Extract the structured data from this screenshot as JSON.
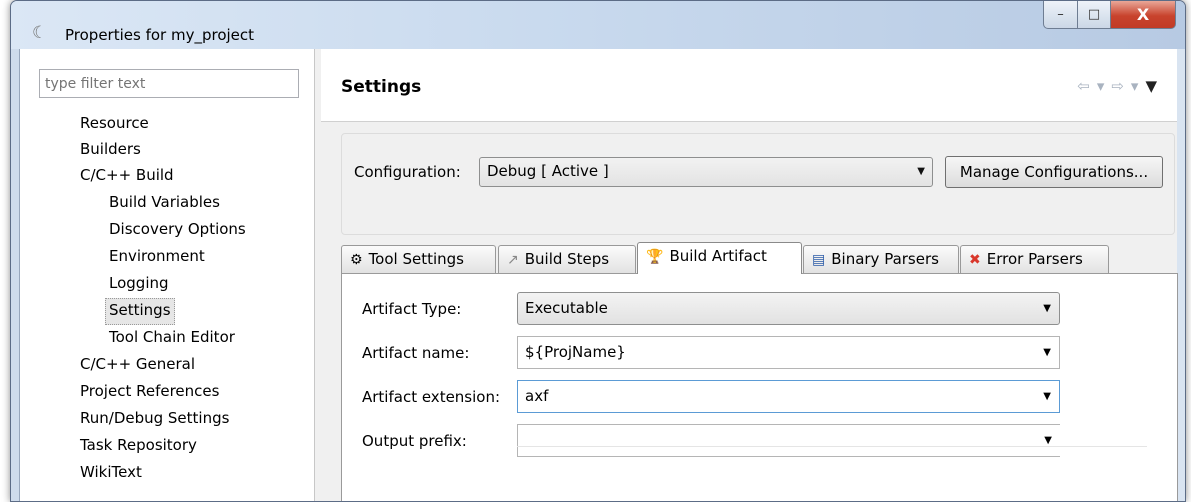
{
  "window": {
    "title": "Properties for my_project",
    "app_icon": "eclipse-icon",
    "controls": {
      "minimize": "–",
      "maximize": "□",
      "close": "X"
    }
  },
  "filter": {
    "placeholder": "type filter text"
  },
  "tree": [
    {
      "label": "Resource",
      "level": 0
    },
    {
      "label": "Builders",
      "level": 0
    },
    {
      "label": "C/C++ Build",
      "level": 0
    },
    {
      "label": "Build Variables",
      "level": 1
    },
    {
      "label": "Discovery Options",
      "level": 1
    },
    {
      "label": "Environment",
      "level": 1
    },
    {
      "label": "Logging",
      "level": 1
    },
    {
      "label": "Settings",
      "level": 1,
      "selected": true
    },
    {
      "label": "Tool Chain Editor",
      "level": 1
    },
    {
      "label": "C/C++ General",
      "level": 0
    },
    {
      "label": "Project References",
      "level": 0
    },
    {
      "label": "Run/Debug Settings",
      "level": 0
    },
    {
      "label": "Task Repository",
      "level": 0
    },
    {
      "label": "WikiText",
      "level": 0
    }
  ],
  "header": {
    "title": "Settings",
    "nav": {
      "back": "⇦",
      "forward": "⇨",
      "dropdown": "▾",
      "menu": "▼"
    }
  },
  "configuration": {
    "label": "Configuration:",
    "value": "Debug  [ Active ]",
    "manage_button": "Manage Configurations..."
  },
  "tabs": [
    {
      "label": "Tool Settings",
      "icon": "gear-icon",
      "glyph": "⚙"
    },
    {
      "label": "Build Steps",
      "icon": "build-steps-icon",
      "glyph": "↗"
    },
    {
      "label": "Build Artifact",
      "icon": "trophy-icon",
      "glyph": "🏆",
      "active": true
    },
    {
      "label": "Binary Parsers",
      "icon": "binary-icon",
      "glyph": "▤"
    },
    {
      "label": "Error Parsers",
      "icon": "error-icon",
      "glyph": "✖"
    }
  ],
  "artifact": {
    "type_label": "Artifact Type:",
    "type_value": "Executable",
    "name_label": "Artifact name:",
    "name_value": "${ProjName}",
    "ext_label": "Artifact extension:",
    "ext_value": "axf",
    "prefix_label": "Output prefix:",
    "prefix_value": ""
  },
  "colors": {
    "accent": "#5b9bd5",
    "close": "#c8432d",
    "error_icon": "#d9372b",
    "trophy": "#e0a000"
  }
}
